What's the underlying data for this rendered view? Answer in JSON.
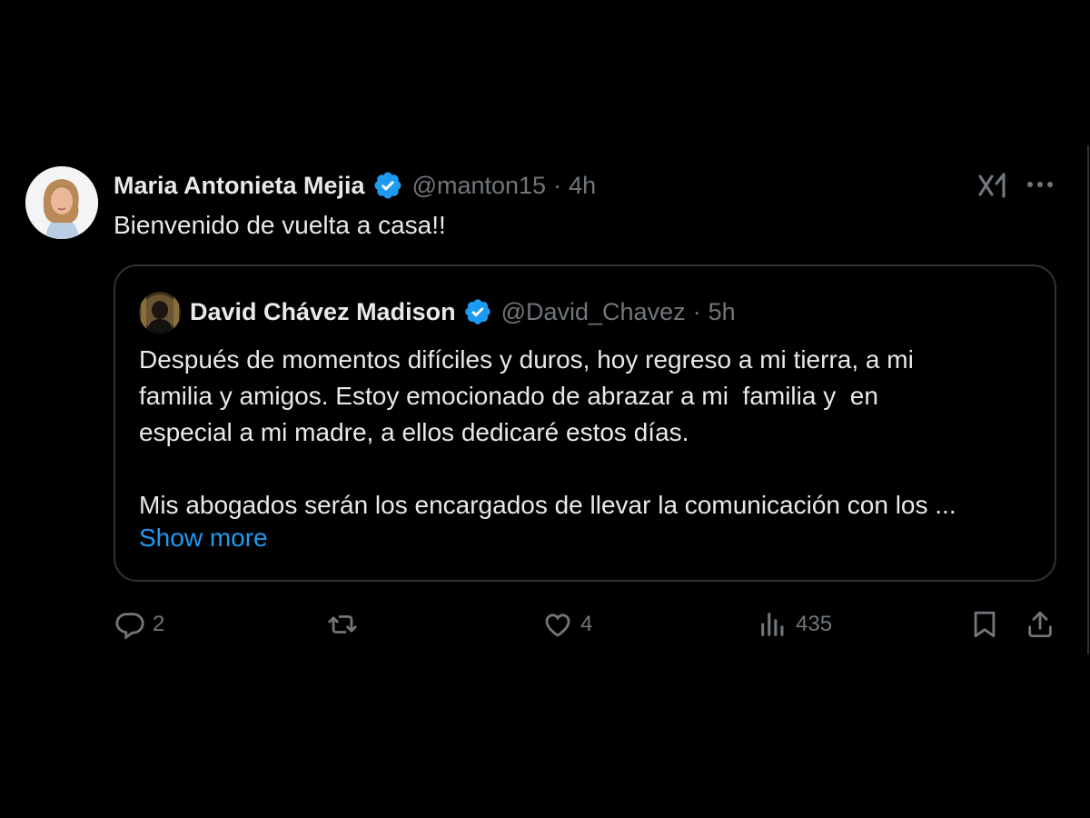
{
  "tweet": {
    "author_name": "Maria Antonieta Mejia",
    "author_handle": "@manton15",
    "separator": "·",
    "time": "4h",
    "text": "Bienvenido de vuelta a casa!!"
  },
  "quote": {
    "author_name": "David Chávez Madison",
    "author_handle": "@David_Chavez",
    "separator": "·",
    "time": "5h",
    "paragraphs": [
      "Después de momentos difíciles y duros, hoy regreso a mi tierra, a mi",
      "familia y amigos. Estoy emocionado de abrazar a mi  familia y  en",
      "especial a mi madre, a ellos dedicaré estos días."
    ],
    "paragraph2": "Mis abogados serán los encargados de llevar la comunicación con los ...",
    "show_more": "Show more"
  },
  "actions": {
    "replies": "2",
    "reposts": "",
    "likes": "4",
    "views": "435"
  },
  "icons": {
    "verified": "verified-badge-icon",
    "grok": "grok-icon",
    "more": "more-icon",
    "reply": "reply-icon",
    "repost": "repost-icon",
    "like": "heart-icon",
    "views": "views-icon",
    "bookmark": "bookmark-icon",
    "share": "share-icon"
  },
  "colors": {
    "background": "#000000",
    "text": "#e7e9ea",
    "secondary": "#71767b",
    "accent": "#1d9bf0",
    "border": "#2f3336"
  }
}
